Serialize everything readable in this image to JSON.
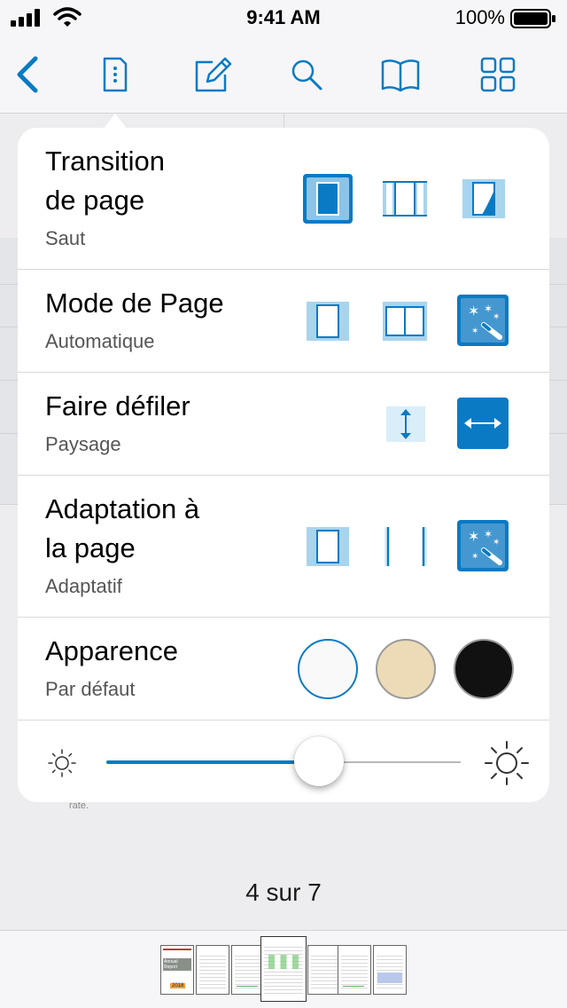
{
  "status_bar": {
    "time": "9:41 AM",
    "battery_percent": "100%"
  },
  "toolbar": {
    "items": [
      {
        "icon": "back-chevron-icon"
      },
      {
        "icon": "document-settings-icon"
      },
      {
        "icon": "annotate-pencil-icon"
      },
      {
        "icon": "search-icon"
      },
      {
        "icon": "book-icon"
      },
      {
        "icon": "grid-icon"
      }
    ]
  },
  "settings": {
    "transition": {
      "title_line1": "Transition",
      "title_line2": "de page",
      "value": "Saut",
      "options": [
        "jump",
        "continuous",
        "curl"
      ],
      "selected": "jump"
    },
    "page_mode": {
      "title": "Mode de Page",
      "value": "Automatique",
      "options": [
        "single",
        "double",
        "automatic"
      ],
      "selected": "automatic"
    },
    "scroll": {
      "title": "Faire défiler",
      "value": "Paysage",
      "options": [
        "vertical",
        "horizontal"
      ],
      "selected": "horizontal"
    },
    "fit": {
      "title_line1": "Adaptation à",
      "title_line2": "la page",
      "value": "Adaptatif",
      "options": [
        "fit-page",
        "fit-width",
        "adaptive"
      ],
      "selected": "adaptive"
    },
    "appearance": {
      "title": "Apparence",
      "value": "Par défaut",
      "options": [
        {
          "name": "default",
          "color": "#f9f9f9",
          "border": "#0a7ac4"
        },
        {
          "name": "sepia",
          "color": "#ecdbb6",
          "border": "#9a9a9a"
        },
        {
          "name": "night",
          "color": "#111111",
          "border": "#9a9a9a"
        }
      ],
      "selected": "default"
    },
    "brightness": {
      "level": 0.6
    }
  },
  "document": {
    "snippet": "rate.",
    "page_indicator": "4 sur 7",
    "thumb_title": "Annual Report",
    "thumb_year": "2018"
  },
  "colors": {
    "accent": "#0a7ac4",
    "accent_light": "#a8d4ee"
  }
}
